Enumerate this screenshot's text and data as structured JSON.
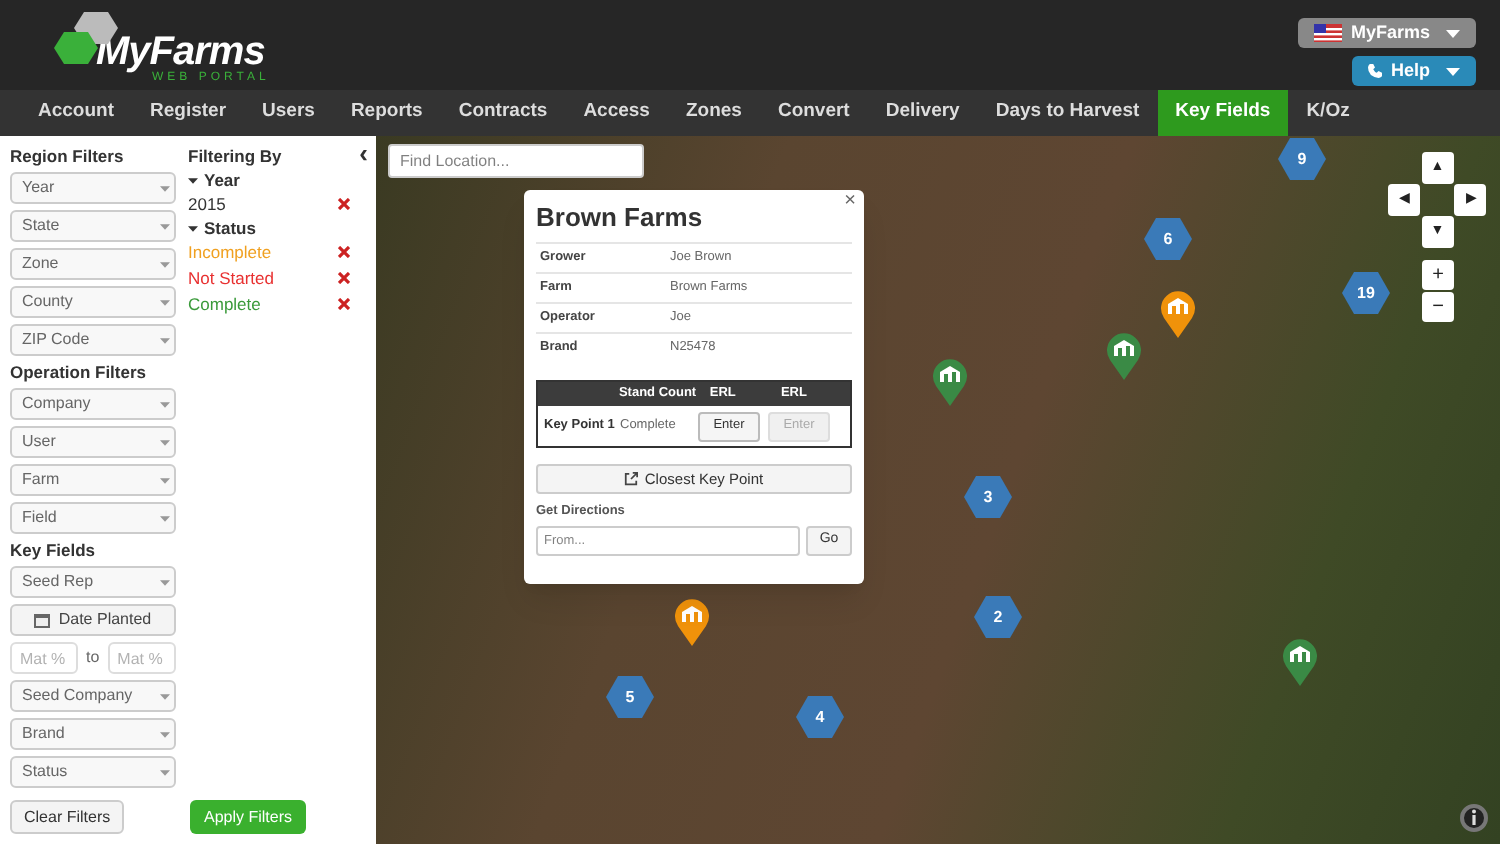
{
  "header": {
    "logo": {
      "title": "MyFarms",
      "subtitle": "WEB PORTAL"
    },
    "account_menu": "MyFarms",
    "help_menu": "Help"
  },
  "nav": [
    {
      "label": "Account",
      "selected": false
    },
    {
      "label": "Register",
      "selected": false
    },
    {
      "label": "Users",
      "selected": false
    },
    {
      "label": "Reports",
      "selected": false
    },
    {
      "label": "Contracts",
      "selected": false
    },
    {
      "label": "Access",
      "selected": false
    },
    {
      "label": "Zones",
      "selected": false
    },
    {
      "label": "Convert",
      "selected": false
    },
    {
      "label": "Delivery",
      "selected": false
    },
    {
      "label": "Days to Harvest",
      "selected": false
    },
    {
      "label": "Key Fields",
      "selected": true
    },
    {
      "label": "K/Oz",
      "selected": false
    }
  ],
  "sidebar": {
    "sections": [
      {
        "title": "Region Filters",
        "items": [
          {
            "kind": "select",
            "label": "Year"
          },
          {
            "kind": "select",
            "label": "State"
          },
          {
            "kind": "select",
            "label": "Zone"
          },
          {
            "kind": "select",
            "label": "County"
          },
          {
            "kind": "select",
            "label": "ZIP Code"
          }
        ]
      },
      {
        "title": "Operation Filters",
        "items": [
          {
            "kind": "select",
            "label": "Company"
          },
          {
            "kind": "select",
            "label": "User"
          },
          {
            "kind": "select",
            "label": "Farm"
          },
          {
            "kind": "select",
            "label": "Field"
          }
        ]
      },
      {
        "title": "Key Fields",
        "items": [
          {
            "kind": "select",
            "label": "Seed Rep"
          },
          {
            "kind": "date",
            "label": "Date Planted"
          },
          {
            "kind": "range",
            "from_placeholder": "Mat %",
            "separator": "to",
            "to_placeholder": "Mat %"
          },
          {
            "kind": "select",
            "label": "Seed Company"
          },
          {
            "kind": "select",
            "label": "Brand"
          },
          {
            "kind": "select",
            "label": "Status"
          }
        ]
      }
    ],
    "filtering_by": {
      "title": "Filtering By",
      "groups": [
        {
          "name": "Year",
          "values": [
            {
              "label": "2015",
              "color": "#333333"
            }
          ]
        },
        {
          "name": "Status",
          "values": [
            {
              "label": "Incomplete",
              "color": "#f0a020"
            },
            {
              "label": "Not Started",
              "color": "#e83030"
            },
            {
              "label": "Complete",
              "color": "#3a9a3a"
            }
          ]
        }
      ]
    },
    "collapse": "‹",
    "clear_button": "Clear Filters",
    "apply_button": "Apply Filters"
  },
  "map": {
    "search": {
      "placeholder": "Find Location..."
    },
    "clusters": [
      "9",
      "6",
      "19",
      "3",
      "2",
      "5",
      "4"
    ],
    "pins": [
      {
        "color": "#f0920a"
      },
      {
        "color": "#3a8a45"
      },
      {
        "color": "#3a8a45"
      },
      {
        "color": "#f0920a"
      },
      {
        "color": "#3a8a45"
      }
    ],
    "controls": {
      "pan": [
        "▲",
        "◀",
        "▶",
        "▼"
      ],
      "zoom": [
        "+",
        "−"
      ]
    },
    "popup": {
      "title": "Brown Farms",
      "close": "×",
      "details": [
        {
          "label": "Grower",
          "value": "Joe Brown"
        },
        {
          "label": "Farm",
          "value": "Brown Farms"
        },
        {
          "label": "Operator",
          "value": "Joe"
        },
        {
          "label": "Brand",
          "value": "N25478"
        }
      ],
      "table": {
        "columns": [
          "Stand Count",
          "ERL",
          "ERL"
        ],
        "rows": [
          {
            "name": "Key Point 1",
            "status": "Complete",
            "buttons": [
              {
                "label": "Enter",
                "disabled": false
              },
              {
                "label": "Enter",
                "disabled": true
              }
            ]
          }
        ]
      },
      "closest_button": "Closest Key Point",
      "directions_label": "Get Directions",
      "from": {
        "placeholder": "From..."
      },
      "go_button": "Go"
    }
  }
}
